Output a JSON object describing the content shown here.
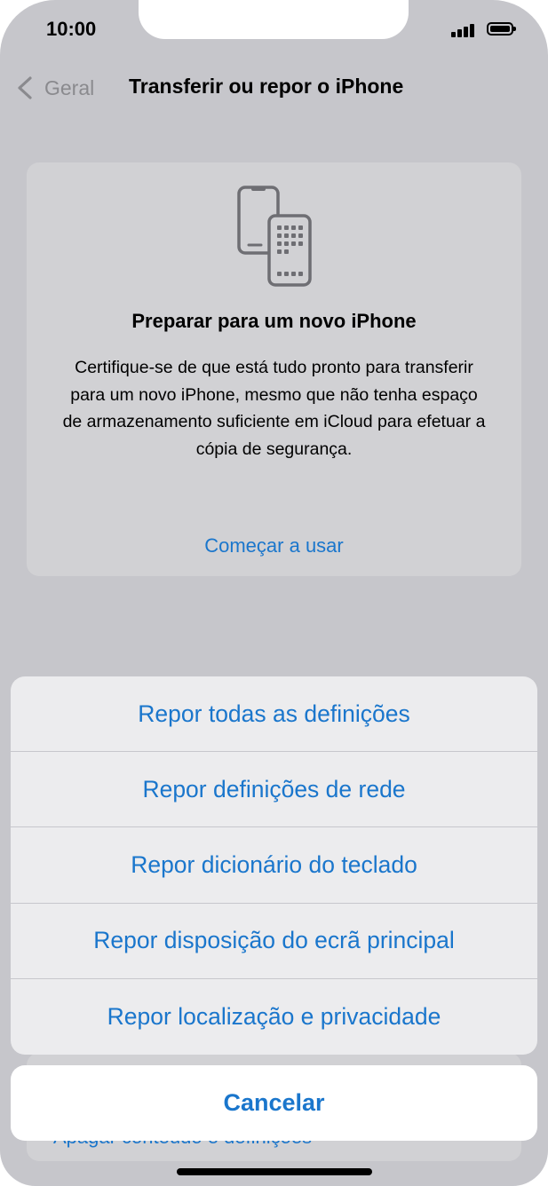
{
  "status_bar": {
    "time": "10:00"
  },
  "nav": {
    "back_label": "Geral",
    "title": "Transferir ou repor o iPhone"
  },
  "prepare_card": {
    "icon": "two-phones-icon",
    "title": "Preparar para um novo iPhone",
    "body": "Certifique-se de que está tudo pronto para transferir para um novo iPhone, mesmo que não tenha espaço de armazenamento suficiente em iCloud para efetuar a cópia de segurança.",
    "link": "Começar a usar"
  },
  "background_partial": {
    "erase_label": "Apagar conteúdo e definições"
  },
  "action_sheet": {
    "items": [
      "Repor todas as definições",
      "Repor definições de rede",
      "Repor dicionário do teclado",
      "Repor disposição do ecrã principal",
      "Repor localização e privacidade"
    ],
    "cancel": "Cancelar"
  },
  "colors": {
    "accent": "#1a76cc",
    "dim_background": "#c6c6cb",
    "sheet_background": "#ececee"
  }
}
